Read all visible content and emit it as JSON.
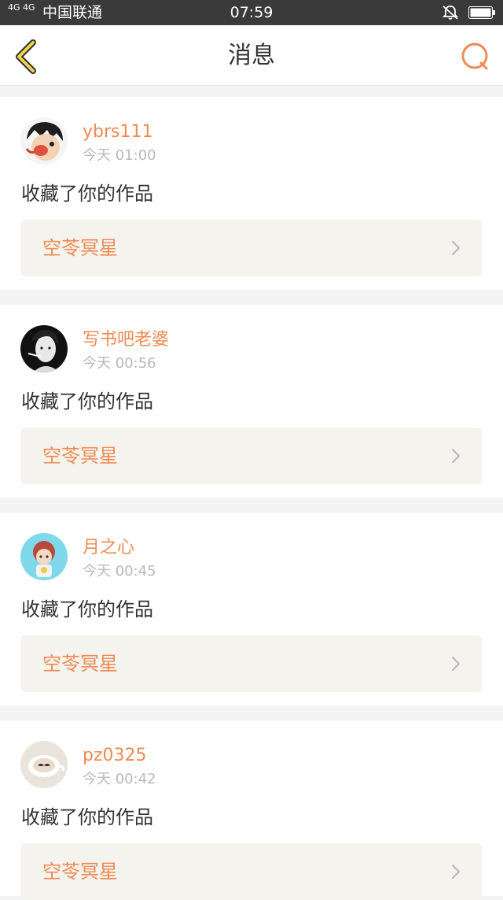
{
  "status_bar": {
    "network": "4G 4G",
    "carrier": "中国联通",
    "time": "07:59"
  },
  "header": {
    "title": "消息",
    "accent_color": "#f08a52",
    "back_icon": "chevron-left-icon",
    "search_icon": "search-icon"
  },
  "messages": [
    {
      "user": "ybrs111",
      "time": "今天 01:00",
      "action": "收藏了你的作品",
      "work": "空苓冥星",
      "avatar": "cartoon-boy-avatar"
    },
    {
      "user": "写书吧老婆",
      "time": "今天 00:56",
      "action": "收藏了你的作品",
      "work": "空苓冥星",
      "avatar": "woman-portrait-avatar"
    },
    {
      "user": "月之心",
      "time": "今天 00:45",
      "action": "收藏了你的作品",
      "work": "空苓冥星",
      "avatar": "anime-child-avatar"
    },
    {
      "user": "pz0325",
      "time": "今天 00:42",
      "action": "收藏了你的作品",
      "work": "空苓冥星",
      "avatar": "coffee-cup-avatar"
    }
  ]
}
